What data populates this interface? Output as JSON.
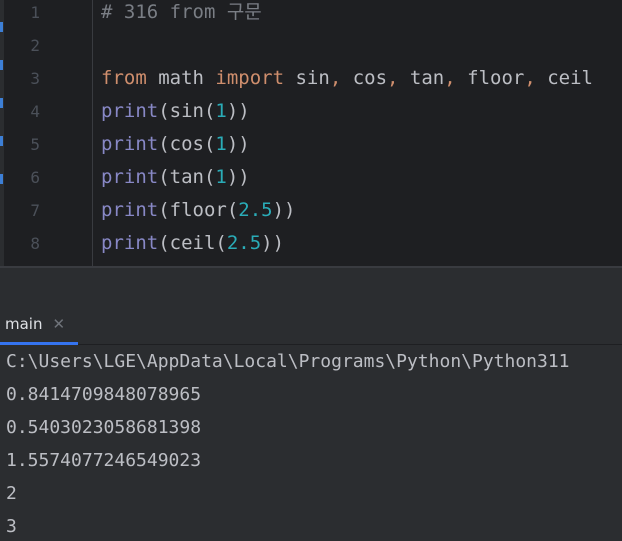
{
  "editor": {
    "line_numbers": [
      "1",
      "2",
      "3",
      "4",
      "5",
      "6",
      "7",
      "8"
    ],
    "lines": [
      {
        "tokens": [
          {
            "t": "# 316 from 구문",
            "c": "cm"
          }
        ]
      },
      {
        "tokens": []
      },
      {
        "tokens": [
          {
            "t": "from",
            "c": "kw"
          },
          {
            "t": " math ",
            "c": "plain"
          },
          {
            "t": "import",
            "c": "kw"
          },
          {
            "t": " sin",
            "c": "plain"
          },
          {
            "t": ",",
            "c": "kw"
          },
          {
            "t": " cos",
            "c": "plain"
          },
          {
            "t": ",",
            "c": "kw"
          },
          {
            "t": " tan",
            "c": "plain"
          },
          {
            "t": ",",
            "c": "kw"
          },
          {
            "t": " floor",
            "c": "plain"
          },
          {
            "t": ",",
            "c": "kw"
          },
          {
            "t": " ceil",
            "c": "plain"
          }
        ]
      },
      {
        "tokens": [
          {
            "t": "print",
            "c": "fn"
          },
          {
            "t": "(sin(",
            "c": "plain"
          },
          {
            "t": "1",
            "c": "num"
          },
          {
            "t": "))",
            "c": "plain"
          }
        ]
      },
      {
        "tokens": [
          {
            "t": "print",
            "c": "fn"
          },
          {
            "t": "(cos(",
            "c": "plain"
          },
          {
            "t": "1",
            "c": "num"
          },
          {
            "t": "))",
            "c": "plain"
          }
        ]
      },
      {
        "tokens": [
          {
            "t": "print",
            "c": "fn"
          },
          {
            "t": "(tan(",
            "c": "plain"
          },
          {
            "t": "1",
            "c": "num"
          },
          {
            "t": "))",
            "c": "plain"
          }
        ]
      },
      {
        "tokens": [
          {
            "t": "print",
            "c": "fn"
          },
          {
            "t": "(floor(",
            "c": "plain"
          },
          {
            "t": "2.5",
            "c": "num"
          },
          {
            "t": "))",
            "c": "plain"
          }
        ]
      },
      {
        "tokens": [
          {
            "t": "print",
            "c": "fn"
          },
          {
            "t": "(ceil(",
            "c": "plain"
          },
          {
            "t": "2.5",
            "c": "num"
          },
          {
            "t": "))",
            "c": "plain"
          }
        ]
      }
    ]
  },
  "run_panel": {
    "tab_label": "main",
    "tab_close_icon": "close-icon",
    "output_lines": [
      "C:\\Users\\LGE\\AppData\\Local\\Programs\\Python\\Python311",
      "0.8414709848078965",
      "0.5403023058681398",
      "1.5574077246549023",
      "2",
      "3"
    ]
  },
  "colors": {
    "editor_bg": "#1e1f22",
    "panel_bg": "#2b2d30",
    "comment": "#7a7e85",
    "keyword": "#cf8e6d",
    "builtin": "#8888c6",
    "number": "#2aacb8",
    "text": "#bcbec4",
    "accent": "#3574f0"
  }
}
